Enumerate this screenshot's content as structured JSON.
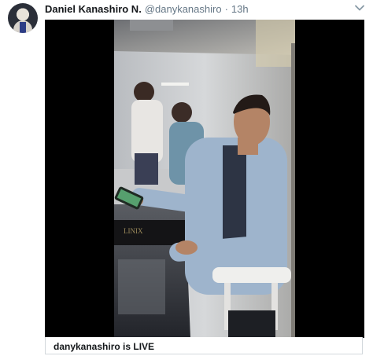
{
  "tweet": {
    "author_name": "Daniel Kanashiro N.",
    "handle": "@danykanashiro",
    "separator": "·",
    "time": "13h",
    "menu_icon": "chevron-down-icon",
    "avatar_icon": "avatar"
  },
  "media": {
    "type": "live-video-frame",
    "caption": "danykanashiro is LIVE"
  }
}
